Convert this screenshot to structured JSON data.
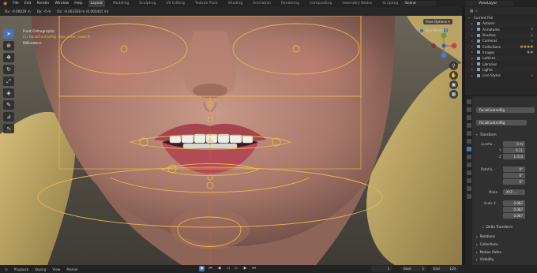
{
  "menus": [
    "File",
    "Edit",
    "Render",
    "Window",
    "Help"
  ],
  "workspaces": [
    "Layout",
    "Modeling",
    "Sculpting",
    "UV Editing",
    "Texture Paint",
    "Shading",
    "Animation",
    "Rendering",
    "Compositing",
    "Geometry Nodes",
    "Scripting"
  ],
  "active_workspace": "Layout",
  "status_measures": [
    "Dx: -0.00029 m",
    "Dy: -0 m",
    "Dz: -0.003358 m (0.003401 m)"
  ],
  "scene_label": "Scene",
  "view_layer_label": "ViewLayer",
  "viewport": {
    "view_name": "Front Orthographic",
    "object_name": "(1) FacialControlRig : lips_outer_lower.R",
    "units": "Millimeters",
    "pose_options": "Pose Options",
    "auto_mirror": "Auto Mirror",
    "auto_mirror_x": "X"
  },
  "toolbar_icons": [
    "cursor-icon",
    "crosshair-icon",
    "move-icon",
    "rotate-icon",
    "scale-icon",
    "transform-icon",
    "annotate-icon",
    "measure-icon",
    "relax-icon"
  ],
  "outliner": {
    "header": "Current File",
    "rows": [
      "Actions",
      "Armatures",
      "Brushes",
      "Cameras",
      "Collections",
      "Images",
      "Lattices",
      "Libraries",
      "Lights",
      "Line Styles"
    ]
  },
  "properties": {
    "object_field": "FacialControlRig",
    "data_field": "FacialControlRig",
    "transform_title": "Transform",
    "location_label": "Locatio...",
    "location": [
      "0 m",
      "0.11",
      "1.413"
    ],
    "rotation_label": "Rotatio...",
    "rotation": [
      "0°",
      "0°",
      "0°"
    ],
    "mode_label": "Mode",
    "mode_value": "XYZ ...",
    "scale_label": "Scale X",
    "scale": [
      "0.087",
      "0.087",
      "0.087"
    ],
    "axis_labels": [
      "X",
      "Y",
      "Z"
    ],
    "sections": [
      "Delta Transform",
      "Relations",
      "Collections",
      "Motion Paths",
      "Visibility",
      "Viewport Display"
    ]
  },
  "bottom": {
    "items": [
      "Playback",
      "Keying",
      "View",
      "Marker"
    ],
    "current_frame": "1",
    "start_label": "Start",
    "start_value": "1",
    "end_label": "End",
    "end_value": "120"
  },
  "colors": {
    "selection_yellow": "#e9b84a",
    "active_blue": "#4772b3",
    "skin": "#b98b7a",
    "lips": "#a4444d",
    "hair_yellow": "#c9b16b"
  }
}
